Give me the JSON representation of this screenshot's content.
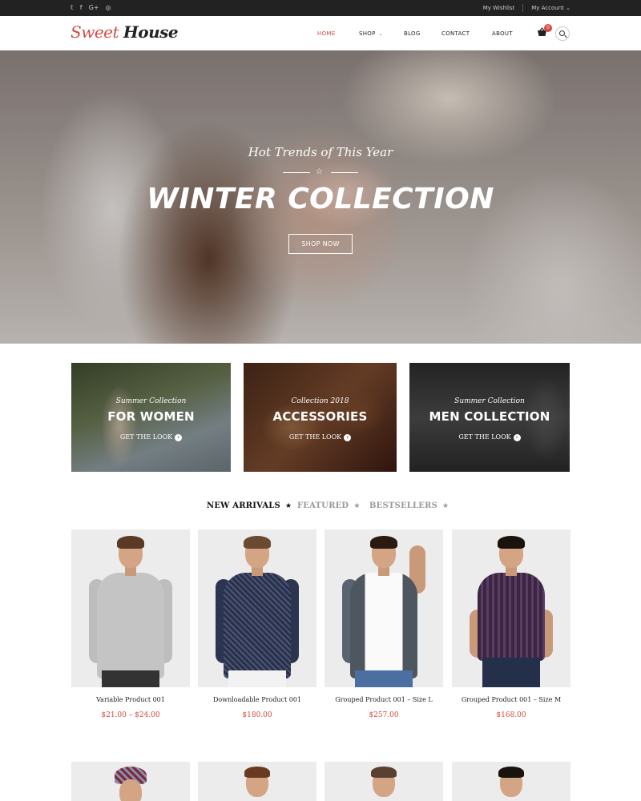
{
  "topbar": {
    "social": [
      {
        "icon": "twitter-icon",
        "glyph": "𝕥"
      },
      {
        "icon": "facebook-icon",
        "glyph": "f"
      },
      {
        "icon": "google-plus-icon",
        "glyph": "G+"
      },
      {
        "icon": "instagram-icon",
        "glyph": "◎"
      }
    ],
    "wishlist": "My Wishlist",
    "account": "My Account",
    "account_chevron": "⌄"
  },
  "header": {
    "logo_part1": "Sweet",
    "logo_part2": "House",
    "nav": {
      "home": "HOME",
      "shop": "SHOP",
      "shop_chevron": "⌄",
      "blog": "BLOG",
      "contact": "CONTACT",
      "about": "ABOUT"
    },
    "cart_glyph": "🛒",
    "cart_count": "0"
  },
  "hero": {
    "subtitle": "Hot Trends of This Year",
    "star": "☆",
    "title": "WINTER COLLECTION",
    "button": "SHOP NOW"
  },
  "banners": [
    {
      "small": "Summer Collection",
      "big": "FOR WOMEN",
      "cta": "GET THE LOOK",
      "arrow": "›"
    },
    {
      "small": "Collection 2018",
      "big": "ACCESSORIES",
      "cta": "GET THE LOOK",
      "arrow": "›"
    },
    {
      "small": "Summer Collection",
      "big": "MEN COLLECTION",
      "cta": "GET THE LOOK",
      "arrow": "›"
    }
  ],
  "tabs": [
    {
      "label": "NEW ARRIVALS",
      "star": "★"
    },
    {
      "label": "FEATURED",
      "star": "★"
    },
    {
      "label": "BESTSELLERS",
      "star": "★"
    }
  ],
  "products": [
    {
      "name": "Variable Product 001",
      "price": "$21.00 – $24.00"
    },
    {
      "name": "Downloadable Product 001",
      "price": "$180.00"
    },
    {
      "name": "Grouped Product 001 – Size L",
      "price": "$257.00"
    },
    {
      "name": "Grouped Product 001 – Size M",
      "price": "$168.00"
    }
  ],
  "colors": {
    "accent": "#d44a3f",
    "topbar_bg": "#222222",
    "product_bg": "#ececec"
  }
}
